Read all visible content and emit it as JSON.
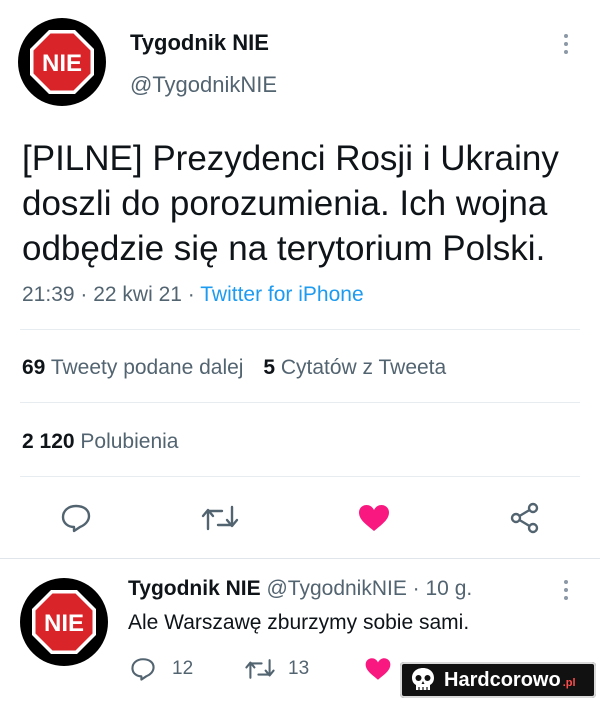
{
  "tweet": {
    "avatar_text": "NIE",
    "author_name": "Tygodnik NIE",
    "author_handle": "@TygodnikNIE",
    "text_lines": [
      "[PILNE] Prezydenci Rosji i Ukrainy",
      "doszli do porozumienia. Ich wojna",
      "odbędzie się na terytorium Polski."
    ],
    "time_date": "21:39 · 22 kwi 21 ·",
    "source": "Twitter for iPhone",
    "retweets_count": "69",
    "retweets_label": "Tweety podane dalej",
    "quotes_count": "5",
    "quotes_label": "Cytatów z Tweeta",
    "likes_count": "2 120",
    "likes_label": "Polubienia"
  },
  "reply": {
    "avatar_text": "NIE",
    "author_name": "Tygodnik NIE",
    "author_meta": "@TygodnikNIE · 10 g.",
    "text": "Ale Warszawę zburzymy sobie sami.",
    "reply_count": "12",
    "retweet_count": "13"
  },
  "watermark": {
    "text": "Hardcorowo",
    "suffix": ".pl"
  },
  "colors": {
    "accent": "#1d9bf0",
    "like": "#f91880",
    "stop_sign": "#d9252a"
  },
  "icons": [
    "stop-sign-logo",
    "more-icon",
    "reply-icon",
    "retweet-icon",
    "heart-icon",
    "share-icon",
    "skull-icon"
  ]
}
